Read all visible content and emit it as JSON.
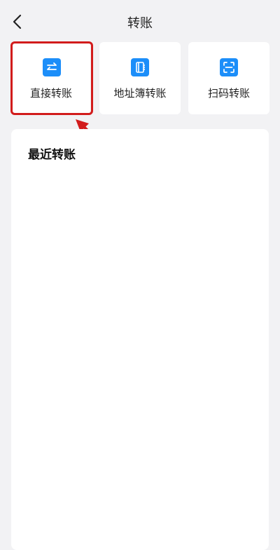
{
  "header": {
    "title": "转账",
    "back_icon": "chevron-left-icon"
  },
  "options": [
    {
      "label": "直接转账",
      "icon": "transfer-arrows-icon"
    },
    {
      "label": "地址簿转账",
      "icon": "address-book-icon"
    },
    {
      "label": "扫码转账",
      "icon": "scan-code-icon"
    }
  ],
  "recent": {
    "title": "最近转账"
  },
  "colors": {
    "accent": "#1c8ef9",
    "highlight": "#d21c1c",
    "background": "#f2f2f4"
  }
}
